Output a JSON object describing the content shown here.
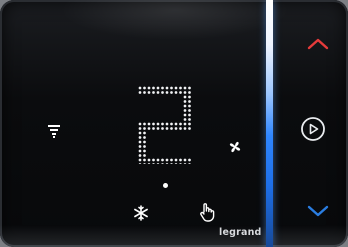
{
  "thermostat": {
    "display_value": "2",
    "brand": "legrand",
    "controls": {
      "up": "chevron-up-icon",
      "mode": "play-circle-icon",
      "down": "chevron-down-icon"
    },
    "indicators": {
      "heating": "heating-icon",
      "fan": "fan-icon",
      "cooling": "snowflake-icon",
      "manual": "hand-icon"
    },
    "colors": {
      "arrow": "#e63b3b",
      "down_arrow": "#2a7de1",
      "strip_top": "#ffffff",
      "strip_bottom": "#1e6fe8"
    }
  }
}
